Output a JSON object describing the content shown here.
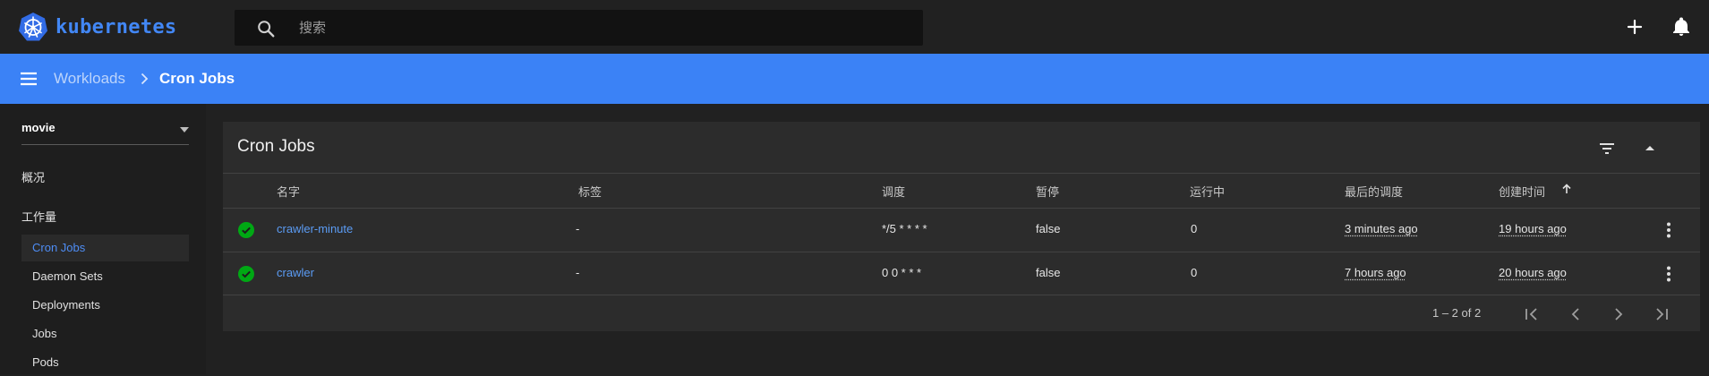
{
  "app": {
    "logo_text": "kubernetes",
    "brand_color": "#326ce5"
  },
  "search": {
    "placeholder": "搜索",
    "value": "",
    "icon": "search-icon"
  },
  "topbar_actions": [
    {
      "icon": "plus-icon"
    },
    {
      "icon": "bell-icon"
    }
  ],
  "breadcrumb": {
    "parent": "Workloads",
    "current": "Cron Jobs",
    "bar_color": "#3b82f6"
  },
  "sidebar": {
    "namespace": "movie",
    "overview": "概况",
    "workloads_heading": "工作量",
    "items": [
      {
        "label": "Cron Jobs",
        "active": true
      },
      {
        "label": "Daemon Sets",
        "active": false
      },
      {
        "label": "Deployments",
        "active": false
      },
      {
        "label": "Jobs",
        "active": false
      },
      {
        "label": "Pods",
        "active": false
      }
    ]
  },
  "card": {
    "title": "Cron Jobs",
    "actions": [
      {
        "icon": "filter-icon"
      },
      {
        "icon": "collapse-icon"
      }
    ]
  },
  "table": {
    "columns": [
      "名字",
      "标签",
      "调度",
      "暂停",
      "运行中",
      "最后的调度",
      "创建时间"
    ],
    "sort_column": "创建时间",
    "sort_direction": "ascending",
    "rows": [
      {
        "status": "success",
        "name": "crawler-minute",
        "labels": "-",
        "schedule": "*/5 * * * *",
        "suspend": "false",
        "active": "0",
        "last_schedule": "3 minutes ago",
        "created": "19 hours ago"
      },
      {
        "status": "success",
        "name": "crawler",
        "labels": "-",
        "schedule": "0 0 * * *",
        "suspend": "false",
        "active": "0",
        "last_schedule": "7 hours ago",
        "created": "20 hours ago"
      }
    ],
    "status_color": "#00a814"
  },
  "pagination": {
    "range": "1 – 2 of 2",
    "buttons": [
      "first-page-icon",
      "previous-page-icon",
      "next-page-icon",
      "last-page-icon"
    ]
  }
}
